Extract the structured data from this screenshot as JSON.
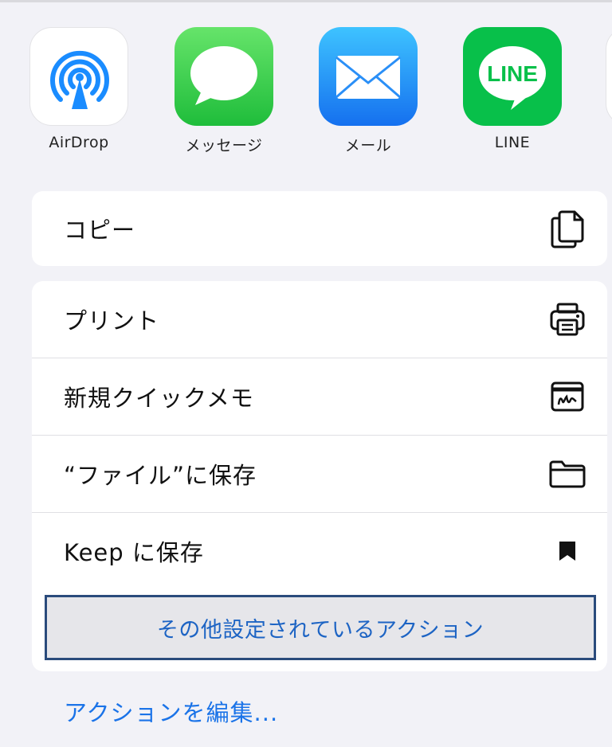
{
  "apps": [
    {
      "label": "AirDrop",
      "icon": "airdrop-icon"
    },
    {
      "label": "メッセージ",
      "icon": "messages-icon"
    },
    {
      "label": "メール",
      "icon": "mail-icon"
    },
    {
      "label": "LINE",
      "icon": "line-icon",
      "logo_text": "LINE"
    }
  ],
  "copy_section": {
    "label": "コピー",
    "icon": "copy-icon"
  },
  "actions": [
    {
      "label": "プリント",
      "icon": "printer-icon"
    },
    {
      "label": "新規クイックメモ",
      "icon": "quick-note-icon"
    },
    {
      "label": "“ファイル”に保存",
      "icon": "folder-icon"
    },
    {
      "label": "Keep に保存",
      "icon": "bookmark-icon"
    }
  ],
  "more_actions_label": "その他設定されているアクション",
  "edit_actions_label": "アクションを編集...",
  "colors": {
    "link": "#1a73e8",
    "highlight_border": "#2a4b7c",
    "background": "#f2f2f7"
  }
}
